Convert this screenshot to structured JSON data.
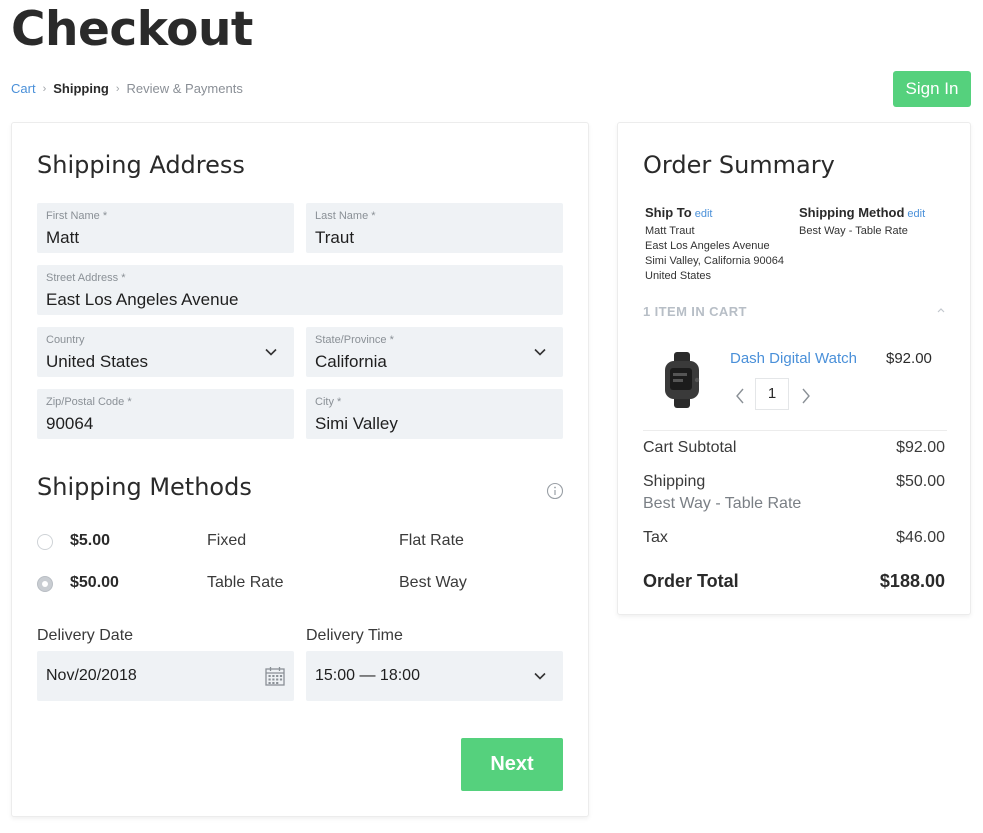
{
  "page": {
    "title": "Checkout"
  },
  "breadcrumb": {
    "cart": "Cart",
    "shipping": "Shipping",
    "review": "Review & Payments",
    "separator": "›"
  },
  "header": {
    "sign_in": "Sign In"
  },
  "shipping_address": {
    "title": "Shipping Address",
    "first_name": {
      "label": "First Name *",
      "value": "Matt"
    },
    "last_name": {
      "label": "Last Name *",
      "value": "Traut"
    },
    "street": {
      "label": "Street Address *",
      "value": "East Los Angeles Avenue"
    },
    "country": {
      "label": "Country",
      "value": "United States"
    },
    "state": {
      "label": "State/Province *",
      "value": "California"
    },
    "zip": {
      "label": "Zip/Postal Code *",
      "value": "90064"
    },
    "city": {
      "label": "City *",
      "value": "Simi Valley"
    }
  },
  "shipping_methods": {
    "title": "Shipping Methods",
    "options": [
      {
        "price": "$5.00",
        "method": "Fixed",
        "carrier": "Flat Rate",
        "selected": false
      },
      {
        "price": "$50.00",
        "method": "Table Rate",
        "carrier": "Best Way",
        "selected": true
      }
    ]
  },
  "delivery": {
    "date_label": "Delivery Date",
    "date_value": "Nov/20/2018",
    "time_label": "Delivery Time",
    "time_value": "15:00 — 18:00"
  },
  "actions": {
    "next": "Next"
  },
  "order_summary": {
    "title": "Order Summary",
    "ship_to": {
      "heading": "Ship To",
      "edit": "edit",
      "lines": [
        "Matt Traut",
        "East Los Angeles Avenue",
        "Simi Valley, California 90064",
        "United States"
      ]
    },
    "shipping_method": {
      "heading": "Shipping Method",
      "edit": "edit",
      "value": "Best Way - Table Rate"
    },
    "cart_count": "1 ITEM IN CART",
    "item": {
      "name": "Dash Digital Watch",
      "price": "$92.00",
      "qty": "1"
    },
    "subtotal": {
      "label": "Cart Subtotal",
      "value": "$92.00"
    },
    "shipping": {
      "label": "Shipping",
      "sub": "Best Way - Table Rate",
      "value": "$50.00"
    },
    "tax": {
      "label": "Tax",
      "value": "$46.00"
    },
    "total": {
      "label": "Order Total",
      "value": "$188.00"
    }
  },
  "colors": {
    "accent_green": "#55d17d",
    "link_blue": "#4a90d9",
    "field_bg": "#eff2f5"
  },
  "icons": [
    "chevron-down-icon",
    "info-icon",
    "calendar-icon",
    "caret-up-icon",
    "chevron-left-icon",
    "chevron-right-icon"
  ]
}
